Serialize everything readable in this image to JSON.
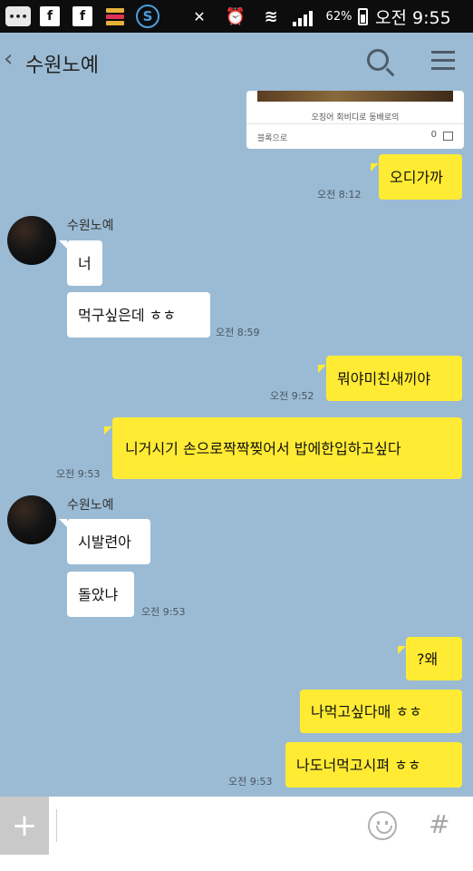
{
  "status_bar": {
    "battery": "62%",
    "time": "오전 9:55"
  },
  "header": {
    "title": "수원노예"
  },
  "shared_card": {
    "caption": "오징어 회비디로 동배로의",
    "source": "블록으로",
    "count": "0"
  },
  "messages": [
    {
      "text": "오디가까",
      "time": "오전 8:12"
    },
    {
      "sender": "수원노예"
    },
    {
      "text": "너"
    },
    {
      "text": "먹구싶은데 ㅎㅎ",
      "time": "오전 8:59"
    },
    {
      "text": "뭐야미친새끼야",
      "time": "오전 9:52"
    },
    {
      "text": "니거시기 손으로짝짝찢어서 밥에한입하고싶다",
      "time": "오전 9:53"
    },
    {
      "sender": "수원노예"
    },
    {
      "text": "시발련아"
    },
    {
      "text": "돌았냐",
      "time": "오전 9:53"
    },
    {
      "text": "?왜"
    },
    {
      "text": "나먹고싶다매 ㅎㅎ"
    },
    {
      "text": "나도너먹고시펴 ㅎㅎ",
      "time": "오전 9:53"
    }
  ],
  "input": {
    "plus": "+",
    "hash": "#"
  },
  "colors": {
    "background": "#9bbbd4",
    "outgoing_bubble": "#ffeb33",
    "incoming_bubble": "#ffffff"
  }
}
